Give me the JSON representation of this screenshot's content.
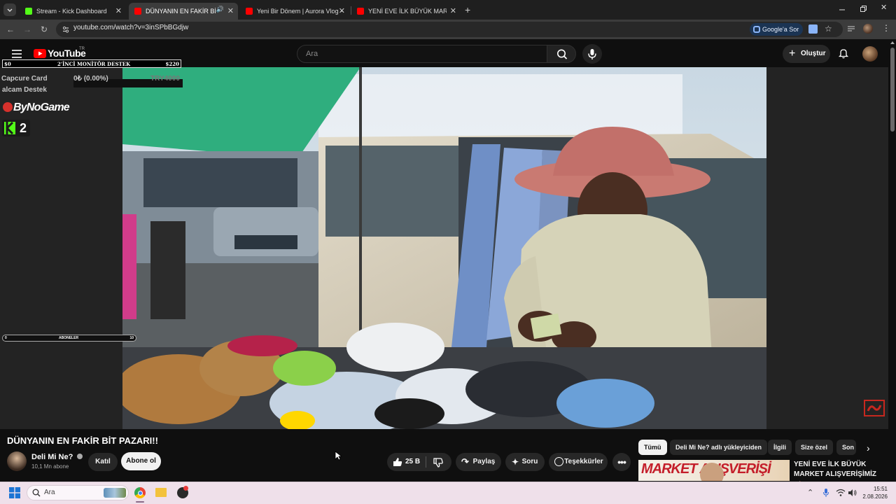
{
  "browser": {
    "tabs": [
      {
        "title": "Stream - Kick Dashboard",
        "favicon_color": "#53fc18",
        "active": false
      },
      {
        "title": "DÜNYANIN EN FAKİR BİT P",
        "favicon_color": "#ff0000",
        "active": true
      },
      {
        "title": "Yeni Bir Dönem | Aurora Vlog -",
        "favicon_color": "#ff0000",
        "active": false
      },
      {
        "title": "YENİ EVE İLK BÜYÜK MARKET A",
        "favicon_color": "#ff0000",
        "active": false
      }
    ],
    "url": "youtube.com/watch?v=3inSPbBGdjw",
    "google_sor": "Google'a Sor"
  },
  "youtube": {
    "logo": "YouTube",
    "country": "TR",
    "search_placeholder": "Ara",
    "create_label": "Oluştur"
  },
  "overlay": {
    "donation_left": "$0",
    "donation_title": "2'İNCİ MONİTÖR DESTEK",
    "donation_right": "$220",
    "goal_name": "Capcure Card",
    "goal_amount": "0₺ (0.00%)",
    "goal_target": "TRY4000",
    "goal_sub": "alcam Destek",
    "brand": "ByNoGame",
    "kick_count": "2",
    "subs_start": "0",
    "subs_label": "ABONELER",
    "subs_end": "10"
  },
  "video": {
    "title": "DÜNYANIN EN FAKİR BİT PAZARI!!",
    "channel": "Deli Mi Ne?",
    "subscribers": "10,1 Mn abone",
    "join_label": "Katıl",
    "subscribe_label": "Abone ol",
    "likes": "25 B",
    "share_label": "Paylaş",
    "ask_label": "Soru",
    "thanks_label": "Teşekkürler"
  },
  "chips": [
    "Tümü",
    "Deli Mi Ne? adlı yükleyiciden",
    "İlgili",
    "Size özel",
    "Son"
  ],
  "recommendation": {
    "thumb_text": "MARKET ALIŞVERİŞİ",
    "title": "YENİ EVE İLK BÜYÜK MARKET ALIŞVERİŞİMİZ"
  },
  "taskbar": {
    "search_placeholder": "Ara",
    "time": "15:51",
    "date": "2.08.2026"
  }
}
